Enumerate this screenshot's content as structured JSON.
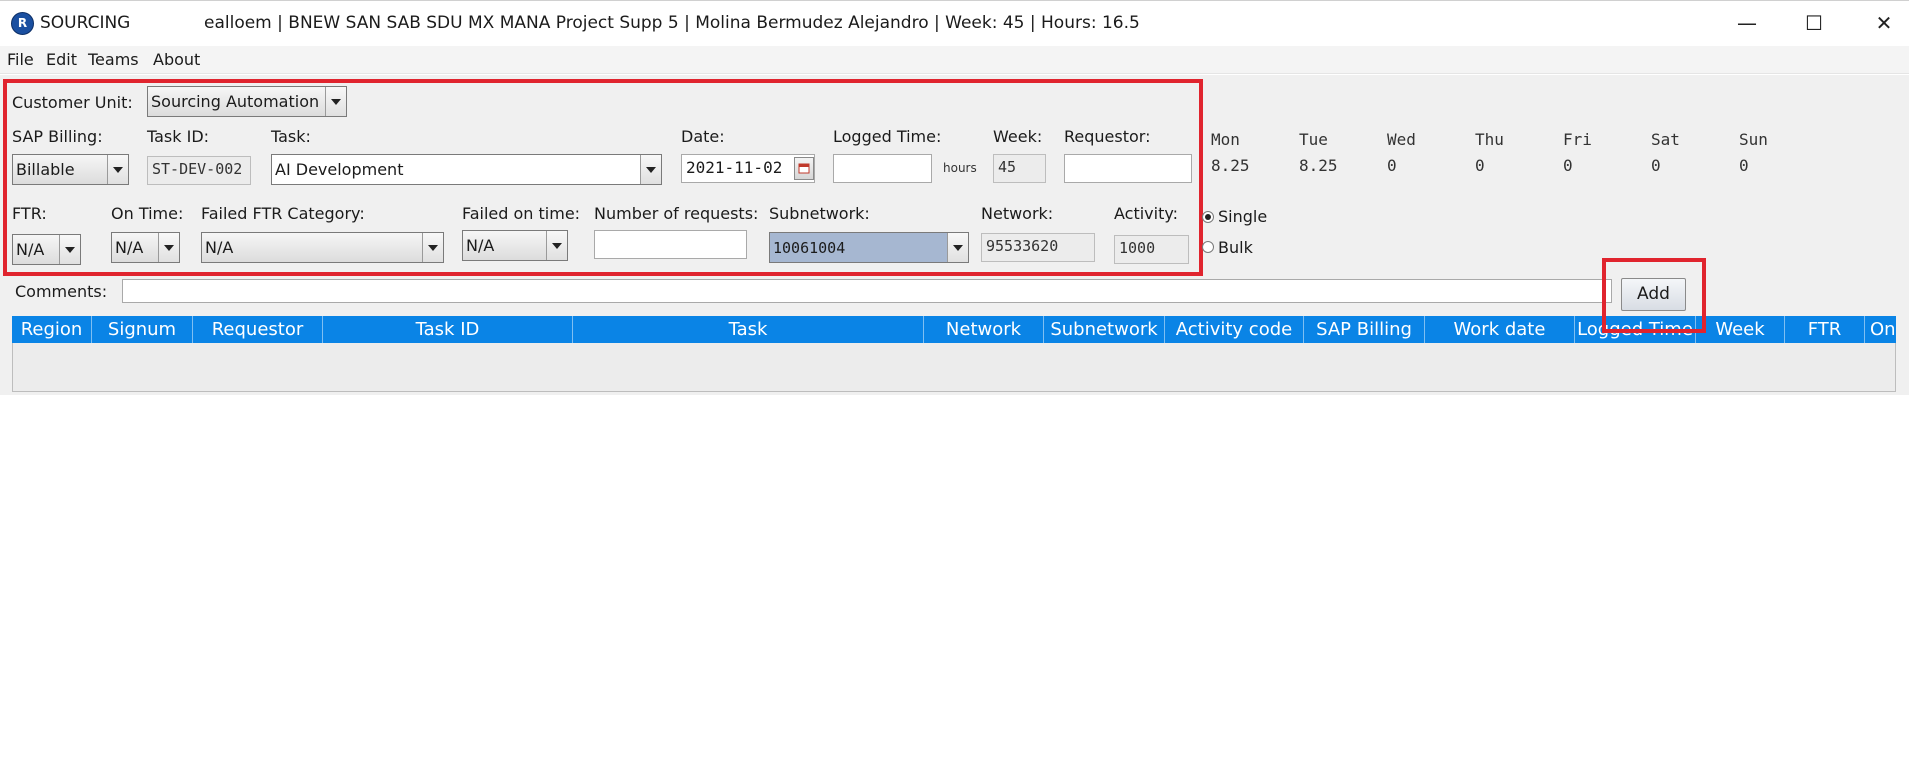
{
  "window": {
    "app_logo": "R",
    "app_name": "SOURCING",
    "title": "ealloem | BNEW SAN SAB SDU MX MANA Project Supp 5 | Molina Bermudez Alejandro | Week: 45 | Hours: 16.5",
    "minimize_icon": "—",
    "maximize_icon": "☐",
    "close_icon": "✕"
  },
  "menu": {
    "items": [
      {
        "label": "File"
      },
      {
        "label": "Edit"
      },
      {
        "label": "Teams"
      },
      {
        "label": "About"
      }
    ]
  },
  "form": {
    "customer_unit": {
      "label": "Customer Unit:",
      "value": "Sourcing Automation"
    },
    "sap_billing": {
      "label": "SAP Billing:",
      "value": "Billable"
    },
    "task_id": {
      "label": "Task ID:",
      "value": "ST-DEV-002"
    },
    "task": {
      "label": "Task:",
      "value": "AI Development"
    },
    "date": {
      "label": "Date:",
      "value": "2021-11-02"
    },
    "logged_time": {
      "label": "Logged Time:",
      "value": "",
      "unit": "hours"
    },
    "week": {
      "label": "Week:",
      "value": "45"
    },
    "requestor": {
      "label": "Requestor:",
      "value": ""
    },
    "ftr": {
      "label": "FTR:",
      "value": "N/A"
    },
    "on_time": {
      "label": "On Time:",
      "value": "N/A"
    },
    "failed_ftr_category": {
      "label": "Failed FTR Category:",
      "value": "N/A"
    },
    "failed_on_time": {
      "label": "Failed on time:",
      "value": "N/A"
    },
    "number_of_requests": {
      "label": "Number of requests:",
      "value": ""
    },
    "subnetwork": {
      "label": "Subnetwork:",
      "value": "10061004"
    },
    "network": {
      "label": "Network:",
      "value": "95533620"
    },
    "activity": {
      "label": "Activity:",
      "value": "1000"
    },
    "comments": {
      "label": "Comments:",
      "value": ""
    },
    "add_label": "Add"
  },
  "week_hours": {
    "days": [
      {
        "day": "Mon",
        "hours": "8.25"
      },
      {
        "day": "Tue",
        "hours": "8.25"
      },
      {
        "day": "Wed",
        "hours": "0"
      },
      {
        "day": "Thu",
        "hours": "0"
      },
      {
        "day": "Fri",
        "hours": "0"
      },
      {
        "day": "Sat",
        "hours": "0"
      },
      {
        "day": "Sun",
        "hours": "0"
      }
    ]
  },
  "entry_mode": {
    "options": [
      {
        "label": "Single",
        "selected": true
      },
      {
        "label": "Bulk",
        "selected": false
      }
    ]
  },
  "table": {
    "header_color": "#0a84e6",
    "columns": [
      "Region",
      "Signum",
      "Requestor",
      "Task ID",
      "Task",
      "Network",
      "Subnetwork",
      "Activity code",
      "SAP Billing",
      "Work date",
      "Logged Time",
      "Week",
      "FTR",
      "On"
    ],
    "rows": []
  },
  "colors": {
    "highlight": "#e0242e",
    "subnetwork_selected_bg": "#a6b7d1"
  }
}
